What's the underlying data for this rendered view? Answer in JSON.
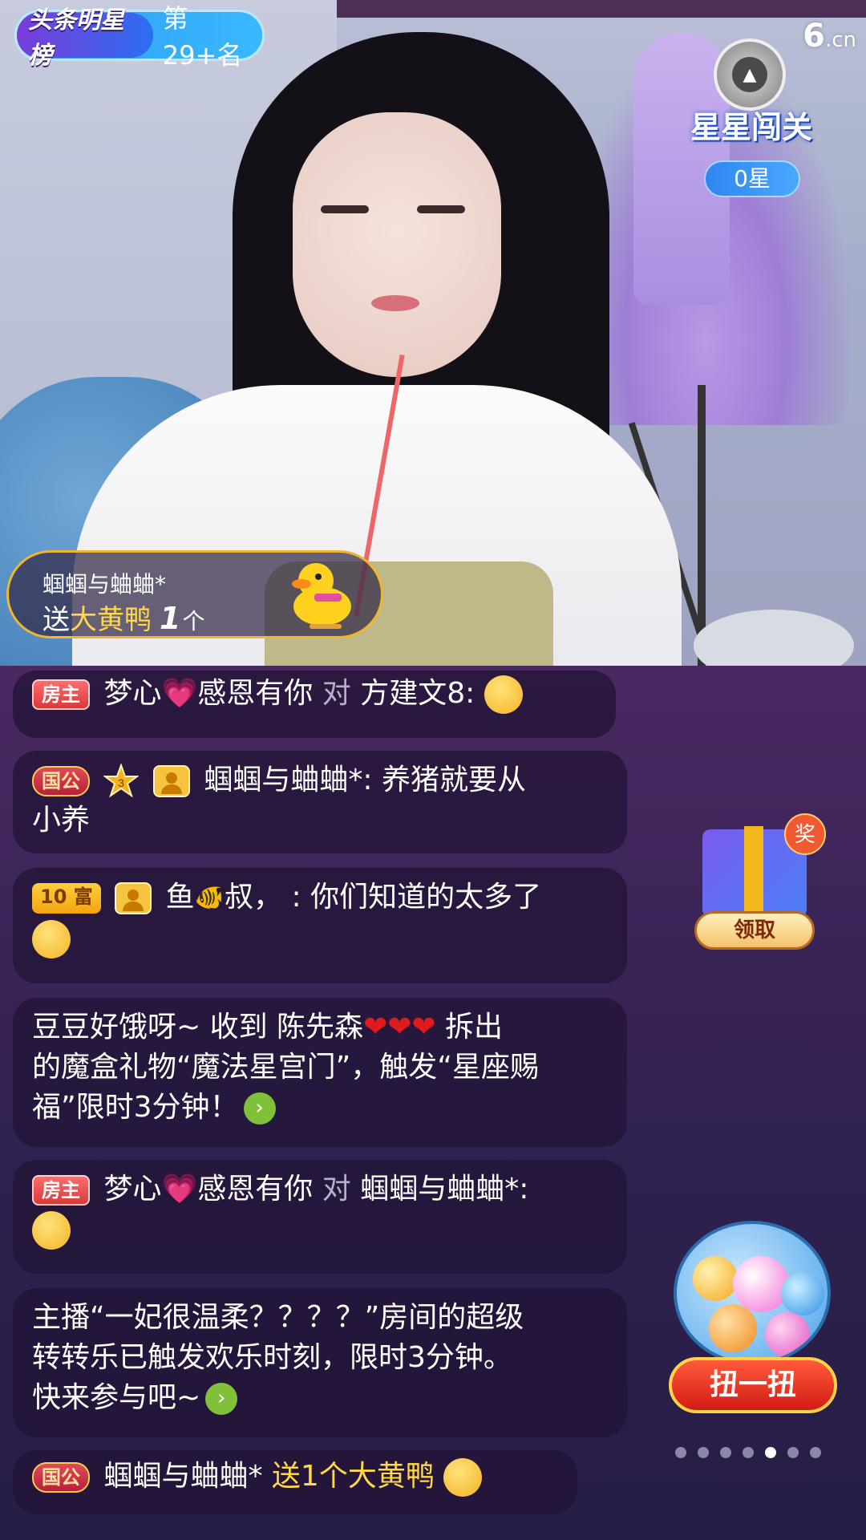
{
  "ranking": {
    "logo": "头条明星榜",
    "rank": "第29+名"
  },
  "brand_logo": {
    "main": "6",
    "suffix": ".cn"
  },
  "star_challenge": {
    "title": "星星闯关",
    "count": "0星"
  },
  "gift_notice": {
    "user": "蝈蝈与蛐蛐*",
    "prefix": "送",
    "gift": "大黄鸭",
    "count": "1",
    "unit": "个"
  },
  "chat": {
    "msg0": {
      "tag": "房主",
      "user": "梦心",
      "user2": "感恩有你",
      "to": "对",
      "target": "方建文8:"
    },
    "msg1": {
      "tag": "国公",
      "level": "3",
      "user": "蝈蝈与蛐蛐*:",
      "text": "养猪就要从",
      "text2": "小养"
    },
    "msg2": {
      "tag": "10 富",
      "user": "鱼",
      "user2": "叔，",
      "text": ": 你们知道的太多了"
    },
    "msg3": {
      "line1a": "豆豆好饿呀~ 收到 陈先森",
      "hearts": "❤❤❤",
      "line1b": " 拆出",
      "line2": "的魔盒礼物“魔法星宫门”，触发“星座赐",
      "line3": "福”限时3分钟！"
    },
    "msg4": {
      "tag": "房主",
      "user": "梦心",
      "user2": "感恩有你",
      "to": "对",
      "target": "蝈蝈与蛐蛐*:"
    },
    "msg5": {
      "line1": "主播“一妃很温柔？？？？”房间的超级",
      "line2": "转转乐已触发欢乐时刻，限时3分钟。",
      "line3": "快来参与吧~"
    },
    "msg6": {
      "tag": "国公",
      "user": "蝈蝈与蛐蛐*",
      "text": "送1个大黄鸭"
    }
  },
  "reward": {
    "badge": "奖",
    "button": "领取"
  },
  "gacha": {
    "button": "扭一扭"
  },
  "pager": {
    "count": 7,
    "active_index": 4
  },
  "icons": [
    "rank-logo-icon",
    "star-emblem-icon",
    "gift-duck-icon",
    "level-star-icon",
    "avatar-icon",
    "emoji-icon",
    "fish-icon",
    "heart-icon",
    "arrow-right-icon",
    "gift-box-icon",
    "gacha-machine-icon"
  ],
  "colors": {
    "accent_gold": "#ffd84a",
    "chat_bubble": "#23143780",
    "host_tag": "#d83a3a",
    "go_button": "#7fc23a"
  }
}
